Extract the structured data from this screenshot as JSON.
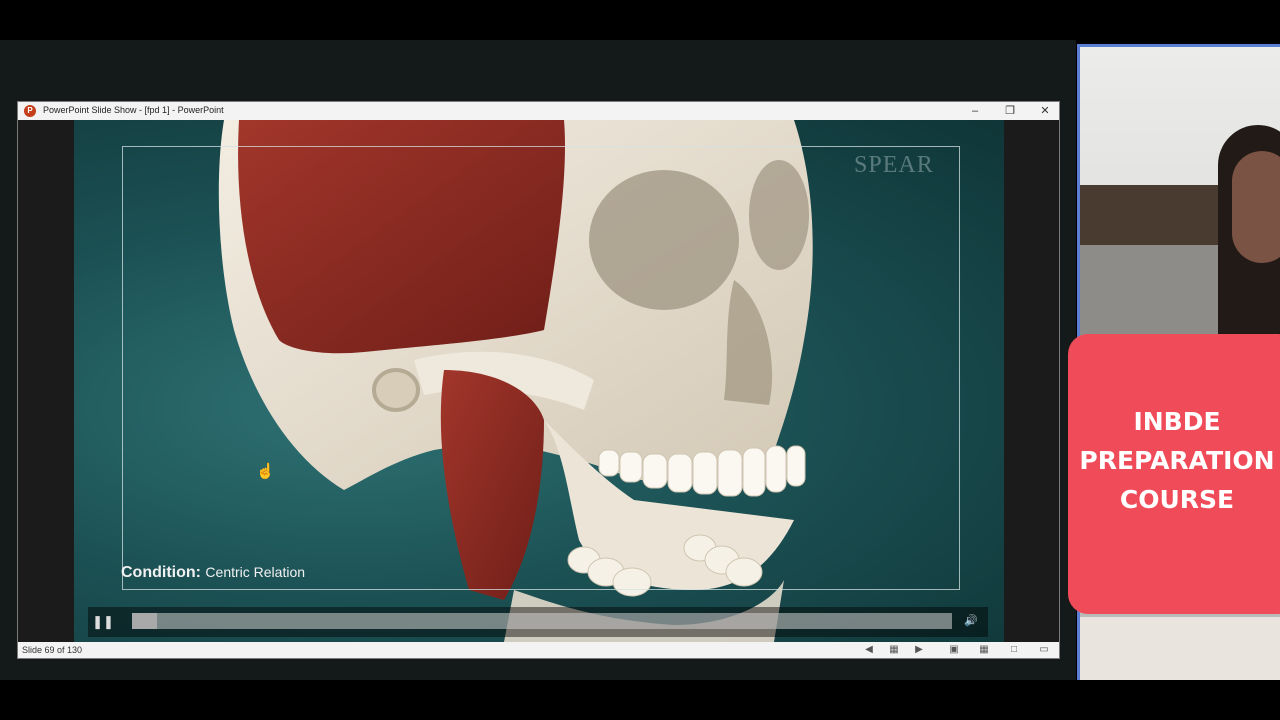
{
  "window": {
    "title": "PowerPoint Slide Show - [fpd 1] - PowerPoint",
    "app_icon": "powerpoint-icon",
    "controls": [
      "minimize-icon",
      "restore-icon",
      "close-icon"
    ]
  },
  "slide": {
    "watermark": "SPEAR",
    "condition_label": "Condition:",
    "condition_value": "Centric Relation"
  },
  "video": {
    "progress": 0.03
  },
  "status": {
    "slide_info": "Slide 69 of 130"
  },
  "side_panel": {
    "title_lines": [
      "INBDE",
      "PREPARATION",
      "COURSE"
    ]
  },
  "colors": {
    "card": "#f04b58",
    "webcam_border": "#5b7fd4",
    "stage_teal": "#1c5255",
    "muscle": "#8e2a22",
    "bone": "#e9e1d2"
  }
}
